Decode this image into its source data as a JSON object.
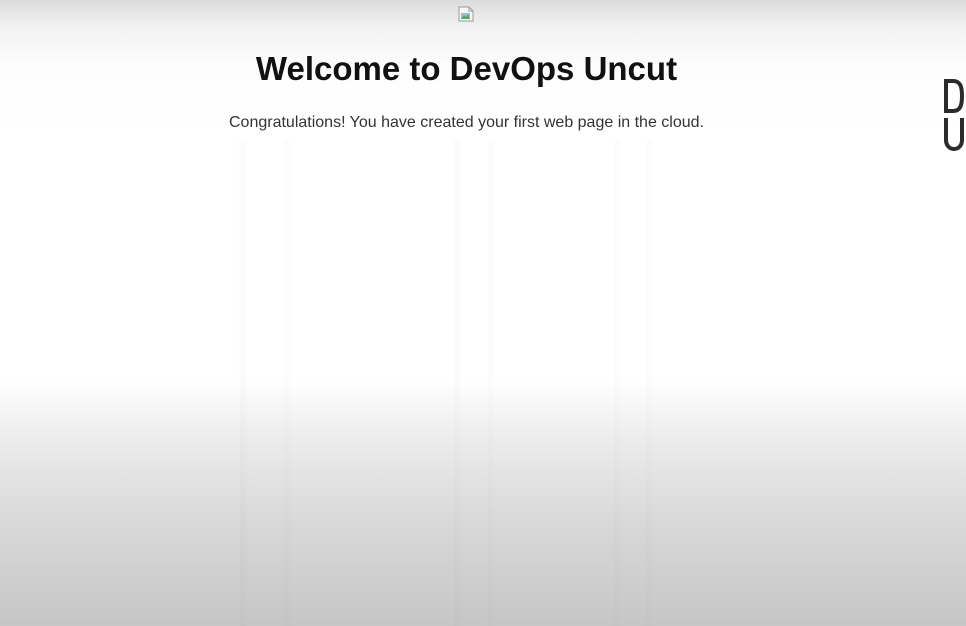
{
  "page": {
    "image_icon": "broken-image-icon",
    "heading": "Welcome to DevOps Uncut",
    "message": "Congratulations! You have created your first web page in the cloud."
  },
  "logo": {
    "text": "DU",
    "color": "#2b2b2b"
  }
}
